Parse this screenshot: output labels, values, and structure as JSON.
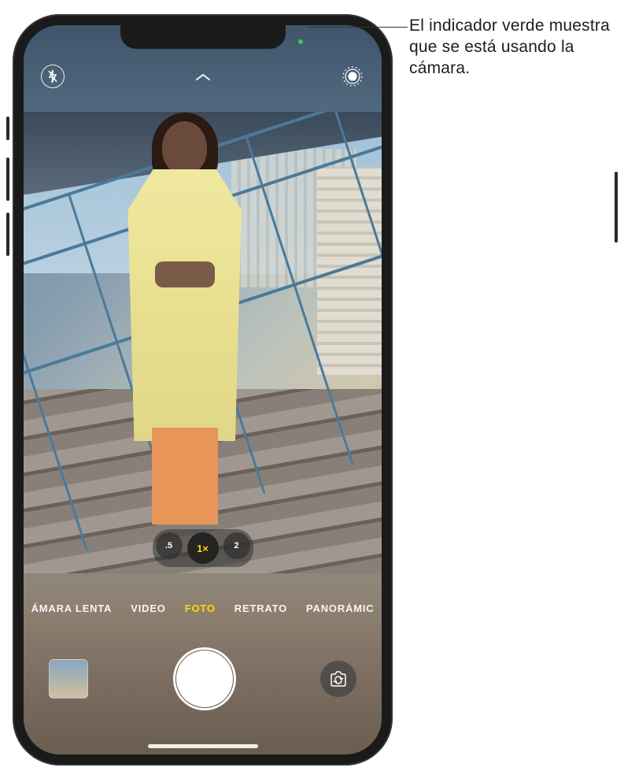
{
  "callout": {
    "text": "El indicador verde muestra que se está usando la cámara."
  },
  "topControls": {
    "flash": "flash-off",
    "chevron": "chevron-up",
    "livePhoto": "live-photo"
  },
  "zoom": {
    "options": [
      ".5",
      "1×",
      "2"
    ],
    "activeIndex": 1
  },
  "modes": {
    "items": [
      "ÁMARA LENTA",
      "VIDEO",
      "FOTO",
      "RETRATO",
      "PANORÁMIC"
    ],
    "activeIndex": 2
  },
  "bottomControls": {
    "thumbnail": "last-photo",
    "shutter": "shutter",
    "flip": "flip-camera"
  },
  "indicator": {
    "color": "#30d158"
  }
}
